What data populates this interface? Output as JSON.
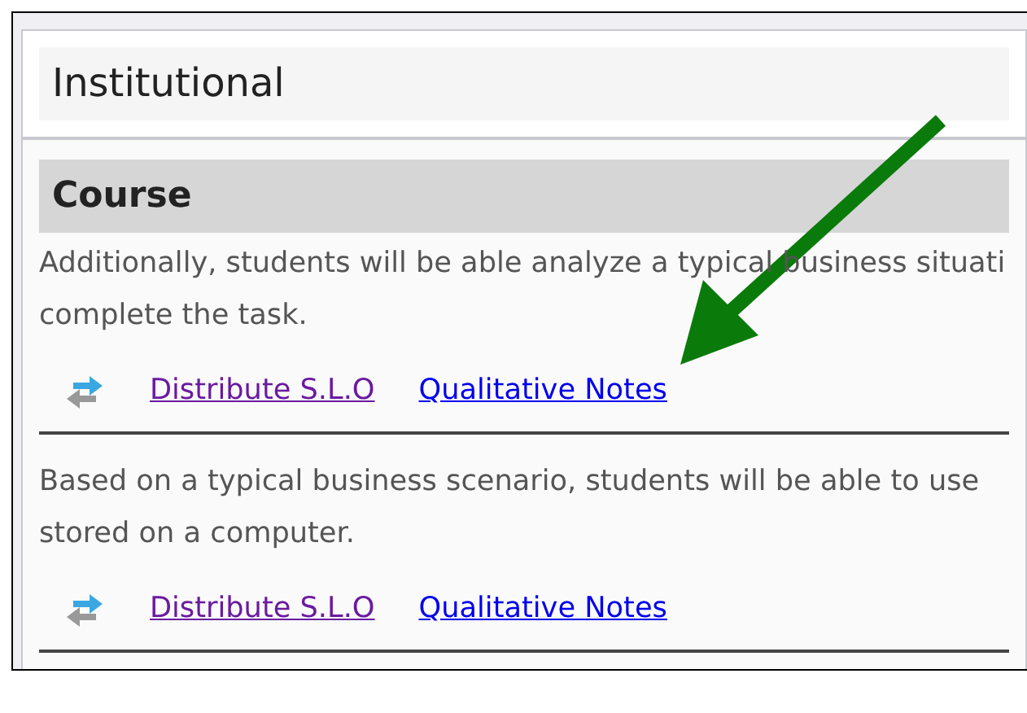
{
  "header": {
    "title": "Institutional"
  },
  "section": {
    "title": "Course",
    "outcomes": [
      {
        "lines": [
          "Additionally, students will be able analyze a typical business situati",
          "complete the task."
        ],
        "links": [
          {
            "label": "Distribute S.L.O",
            "visited": true
          },
          {
            "label": "Qualitative Notes",
            "visited": false
          }
        ]
      },
      {
        "lines": [
          "Based on a typical business scenario, students will be able to use",
          "stored on a computer."
        ],
        "links": [
          {
            "label": "Distribute S.L.O",
            "visited": true
          },
          {
            "label": "Qualitative Notes",
            "visited": false
          }
        ]
      }
    ]
  }
}
